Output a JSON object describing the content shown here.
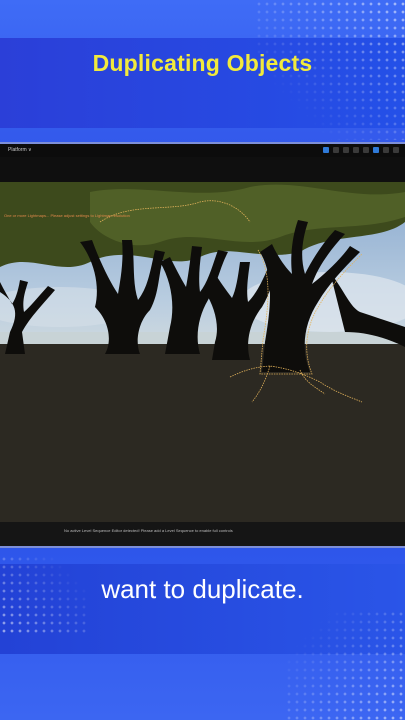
{
  "title": "Duplicating Objects",
  "caption": "want to duplicate.",
  "editor": {
    "menu_label": "Platform ∨",
    "viewport_warning": "One or more Lightmaps... Please adjust settings to Lightmap resolution",
    "status_message": "No active Level Sequence Editor detected! Please add a Level Sequence to enable full controls"
  },
  "colors": {
    "title": "#f2ea3c",
    "background": "#2a4fe0",
    "selection_outline": "#e2b25a"
  }
}
